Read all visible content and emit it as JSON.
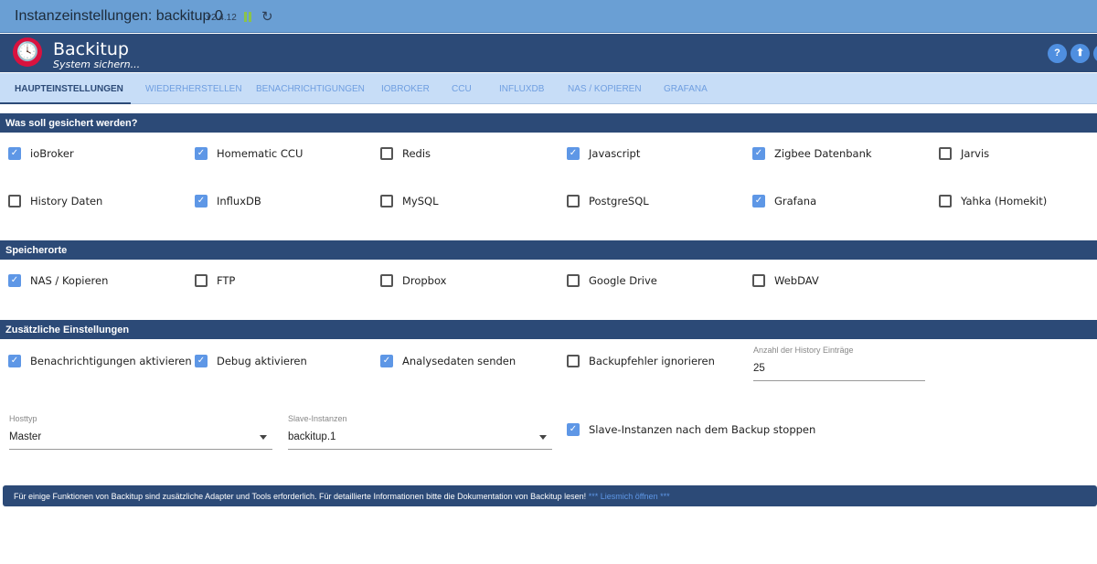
{
  "titlebar": {
    "title": "Instanzeinstellungen: backitup.0",
    "version": "v2.4.12",
    "reload_icon": "↻"
  },
  "header": {
    "brand": "Backitup",
    "subtitle": "System sichern...",
    "buttons": [
      "?",
      "⬆"
    ]
  },
  "tabs": [
    "HAUPTEINSTELLUNGEN",
    "WIEDERHERSTELLEN",
    "BENACHRICHTIGUNGEN",
    "IOBROKER",
    "CCU",
    "INFLUXDB",
    "NAS / KOPIEREN",
    "GRAFANA"
  ],
  "sections": {
    "backup": "Was soll gesichert werden?",
    "storage": "Speicherorte",
    "extra": "Zusätzliche Einstellungen"
  },
  "backup_items": [
    {
      "label": "ioBroker",
      "checked": true
    },
    {
      "label": "Homematic CCU",
      "checked": true
    },
    {
      "label": "Redis",
      "checked": false
    },
    {
      "label": "Javascript",
      "checked": true
    },
    {
      "label": "Zigbee Datenbank",
      "checked": true
    },
    {
      "label": "Jarvis",
      "checked": false
    },
    {
      "label": "History Daten",
      "checked": false
    },
    {
      "label": "InfluxDB",
      "checked": true
    },
    {
      "label": "MySQL",
      "checked": false
    },
    {
      "label": "PostgreSQL",
      "checked": false
    },
    {
      "label": "Grafana",
      "checked": true
    },
    {
      "label": "Yahka (Homekit)",
      "checked": false
    }
  ],
  "storage_items": [
    {
      "label": "NAS / Kopieren",
      "checked": true
    },
    {
      "label": "FTP",
      "checked": false
    },
    {
      "label": "Dropbox",
      "checked": false
    },
    {
      "label": "Google Drive",
      "checked": false
    },
    {
      "label": "WebDAV",
      "checked": false
    }
  ],
  "extra_items": [
    {
      "label": "Benachrichtigungen aktivieren",
      "checked": true
    },
    {
      "label": "Debug aktivieren",
      "checked": true
    },
    {
      "label": "Analysedaten senden",
      "checked": true
    },
    {
      "label": "Backupfehler ignorieren",
      "checked": false
    }
  ],
  "history": {
    "label": "Anzahl der History Einträge",
    "value": "25"
  },
  "hosttyp": {
    "label": "Hosttyp",
    "value": "Master"
  },
  "slave": {
    "label": "Slave-Instanzen",
    "value": "backitup.1"
  },
  "slave_stop": {
    "label": "Slave-Instanzen nach dem Backup stoppen",
    "checked": true
  },
  "info": {
    "text": "Für einige Funktionen von Backitup sind zusätzliche Adapter und Tools erforderlich. Für detaillierte Informationen bitte die Dokumentation von Backitup lesen! ",
    "link": "*** Liesmich öffnen ***"
  }
}
